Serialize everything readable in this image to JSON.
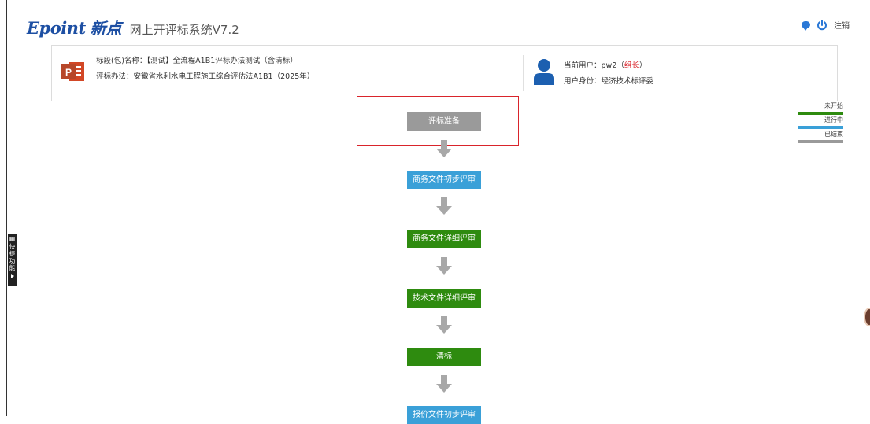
{
  "header": {
    "logo_en": "Epoint",
    "logo_cn": "新点",
    "system_name": "网上开评标系统V7.2",
    "logout_label": "注销",
    "chat_icon": "chat-bubble-icon",
    "power_icon": "power-icon"
  },
  "project_info": {
    "section_line": "标段(包)名称：【测试】全流程A1B1评标办法测试（含清标）",
    "method_line": "评标办法：安徽省水利水电工程施工综合评估法A1B1（2025年）"
  },
  "user_info": {
    "current_user_label": "当前用户：",
    "current_user_name": "pw2",
    "role_open": "（",
    "role": "组长",
    "role_close": "）",
    "identity_line": "用户身份：经济技术标评委"
  },
  "legend": [
    {
      "label": "未开始",
      "color": "#2e8b0f"
    },
    {
      "label": "进行中",
      "color": "#3aa0d8"
    },
    {
      "label": "已结束",
      "color": "#9a9a9a"
    }
  ],
  "steps": [
    {
      "label": "评标准备",
      "color": "#9a9a9a"
    },
    {
      "label": "商务文件初步评审",
      "color": "#3aa0d8"
    },
    {
      "label": "商务文件详细评审",
      "color": "#2e8b0f"
    },
    {
      "label": "技术文件详细评审",
      "color": "#2e8b0f"
    },
    {
      "label": "清标",
      "color": "#2e8b0f"
    },
    {
      "label": "报价文件初步评审",
      "color": "#3aa0d8"
    }
  ],
  "quick_tab": {
    "label_1": "快",
    "label_2": "捷",
    "label_3": "功",
    "label_4": "能"
  }
}
